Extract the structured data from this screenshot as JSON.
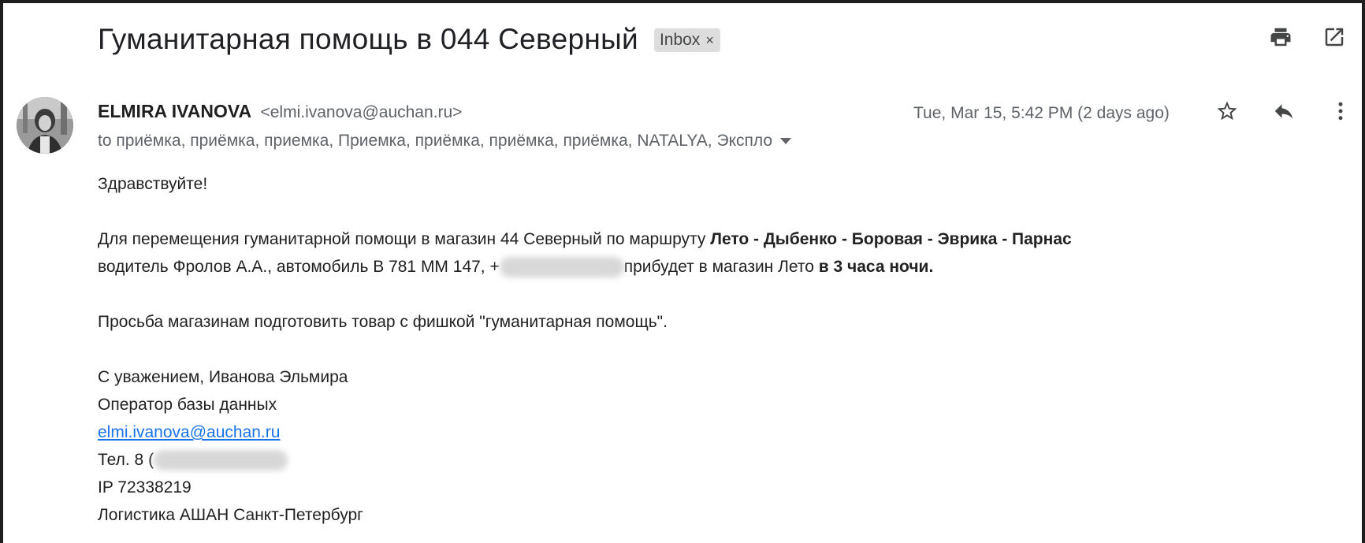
{
  "header": {
    "subject": "Гуманитарная помощь в 044 Северный",
    "label_chip": "Inbox",
    "label_remove": "×",
    "icons": [
      "print-icon",
      "open-in-new-window-icon"
    ]
  },
  "message": {
    "sender_name": "ELMIRA IVANOVA",
    "sender_email": "<elmi.ivanova@auchan.ru>",
    "recipients": "to приёмка, приёмка, приемка, Приемка, приёмка, приёмка, приёмка, NATALYA, Экспло",
    "date": "Tue, Mar 15, 5:42 PM (2 days ago)",
    "icons": [
      "star-icon",
      "reply-icon",
      "more-vert-icon"
    ]
  },
  "body": {
    "greeting": "Здравствуйте!",
    "p1_prefix": "Для перемещения гуманитарной помощи в магазин 44 Северный по  маршруту ",
    "p1_route": "Лето - Дыбенко - Боровая - Эврика - Парнас",
    "p2_prefix": "водитель  Фролов А.А., автомобиль В 781 ММ 147, +",
    "p2_mid": "прибудет в магазин Лето ",
    "p2_time": "в 3 часа ночи.",
    "request": "Просьба магазинам подготовить товар с фишкой \"гуманитарная помощь\".",
    "regards": "С уважением,  Иванова Эльмира",
    "position": "Оператор базы данных",
    "email_link": "elmi.ivanova@auchan.ru",
    "phone_prefix": "Тел. 8 (",
    "ip": "IP 72338219",
    "department": "Логистика АШАН Санкт-Петербург"
  },
  "colors": {
    "link": "#1a73e8",
    "chip_bg": "#dddddd",
    "frame": "#1e1e1e"
  }
}
